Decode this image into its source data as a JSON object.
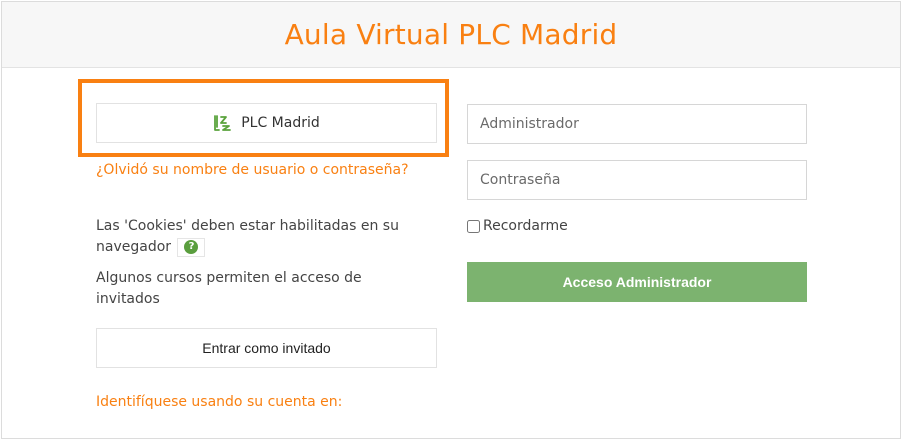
{
  "header": {
    "title": "Aula Virtual PLC Madrid"
  },
  "oauth": {
    "provider_label": "PLC Madrid",
    "icon": "plc-madrid-logo-icon"
  },
  "links": {
    "forgot": "¿Olvidó su nombre de usuario o contraseña?",
    "identify": "Identifíquese usando su cuenta en:"
  },
  "info": {
    "cookies": "Las 'Cookies' deben estar habilitadas en su navegador",
    "help_icon": "question-circle-icon",
    "guest_access": "Algunos cursos permiten el acceso de invitados"
  },
  "guest": {
    "button_label": "Entrar como invitado"
  },
  "form": {
    "username_placeholder": "Administrador",
    "password_placeholder": "Contraseña",
    "remember_label": "Recordarme",
    "remember_checked": false,
    "submit_label": "Acceso Administrador"
  },
  "colors": {
    "accent": "#f98012",
    "submit": "#7cb36f",
    "help": "#5a9e3e"
  }
}
